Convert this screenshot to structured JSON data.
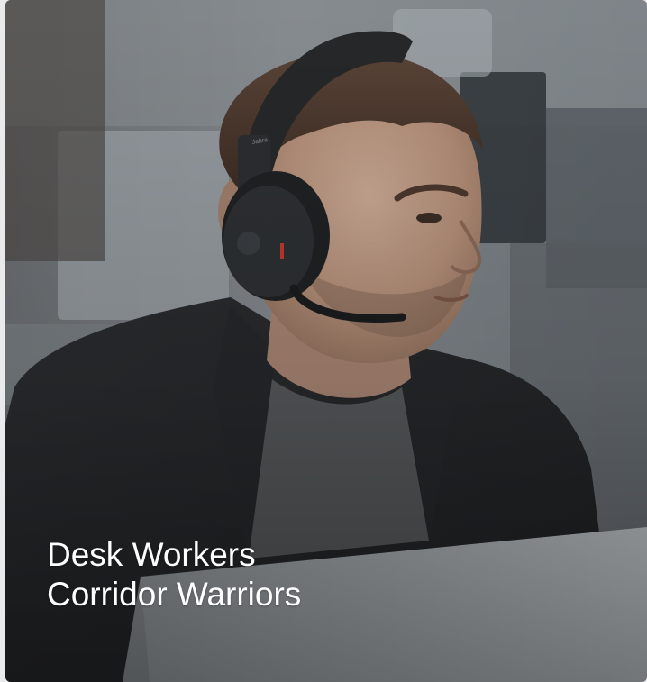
{
  "card": {
    "title_line_1": "Desk Workers",
    "title_line_2": "Corridor Warriors"
  },
  "image": {
    "subject": "person wearing a headset in an office",
    "headset_brand": "Jabra"
  },
  "colors": {
    "caption_text": "#ffffff",
    "overlay": "#000000"
  }
}
